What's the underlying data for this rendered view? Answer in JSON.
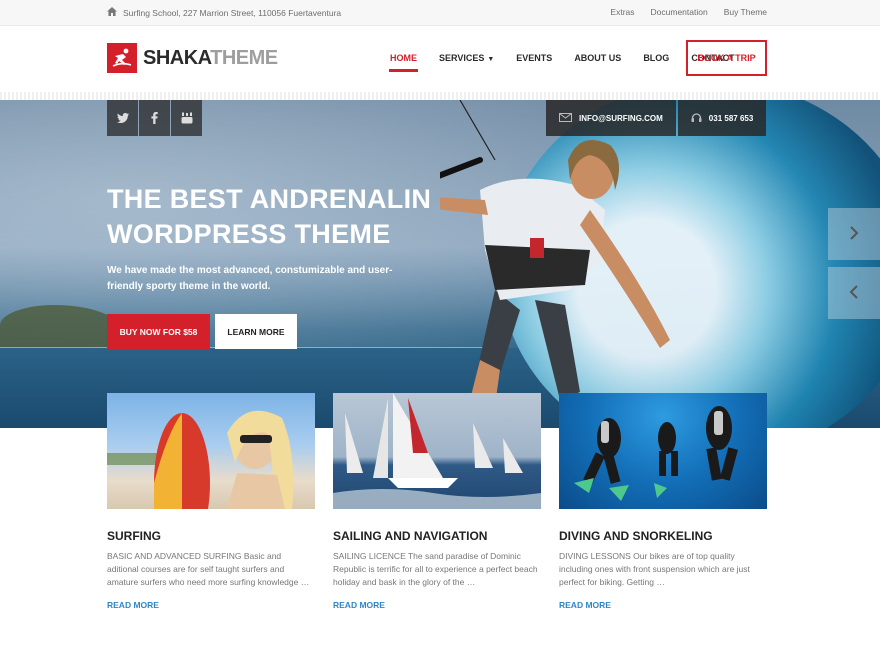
{
  "topbar": {
    "address": "Surfing School, 227 Marrion Street, 110056 Fuertaventura",
    "links": [
      "Extras",
      "Documentation",
      "Buy Theme"
    ]
  },
  "header": {
    "logo_part1": "SHAKA",
    "logo_part2": "THEME",
    "nav": [
      {
        "label": "HOME",
        "active": true
      },
      {
        "label": "SERVICES",
        "has_dropdown": true
      },
      {
        "label": "EVENTS"
      },
      {
        "label": "ABOUT US"
      },
      {
        "label": "BLOG"
      },
      {
        "label": "CONTACT"
      }
    ],
    "book_button": "BOOK A TRIP"
  },
  "hero": {
    "social": [
      "twitter-icon",
      "facebook-icon",
      "youtube-icon"
    ],
    "email": "INFO@SURFING.COM",
    "phone": "031 587 653",
    "title_line1": "THE BEST ANDRENALIN",
    "title_line2": "WORDPRESS THEME",
    "text": "We have made the most advanced, constumizable and user-friendly sporty theme in the world.",
    "primary_button": "BUY NOW FOR $58",
    "secondary_button": "LEARN MORE"
  },
  "cards": [
    {
      "title": "SURFING",
      "text": "BASIC AND ADVANCED SURFING Basic and aditional courses are for self taught surfers and amature surfers who need more surfing knowledge …",
      "link": "READ MORE"
    },
    {
      "title": "SAILING AND NAVIGATION",
      "text": "SAILING LICENCE The sand paradise of Dominic Republic is terrific for all to experience a perfect beach holiday and bask in the glory of the …",
      "link": "READ MORE"
    },
    {
      "title": "DIVING AND SNORKELING",
      "text": "DIVING LESSONS Our bikes are of top quality including ones with front suspension which are just perfect for biking.   Getting …",
      "link": "READ MORE"
    }
  ],
  "colors": {
    "accent": "#d4202a",
    "link": "#2f86c7",
    "dark": "#2b2b2b"
  }
}
